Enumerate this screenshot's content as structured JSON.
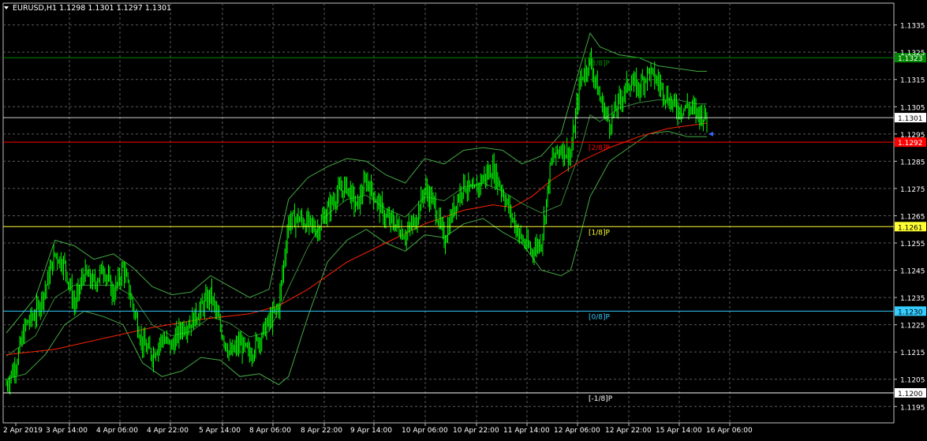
{
  "header": {
    "symbol_line": "EURUSD,H1  1.1298 1.1301 1.1297 1.1301"
  },
  "colors": {
    "background": "#000000",
    "grid": "#5a5a5a",
    "candles": "#00ff00",
    "bands": "#44aa44",
    "ma": "#ff2200",
    "axis_text": "#ffffff",
    "line_2_8": "#ff0000",
    "line_1_8": "#ffff33",
    "line_0_8": "#33ccff",
    "line_neg1_8": "#ffffff",
    "line_3_8": "#008800",
    "line_current": "#ffffff"
  },
  "chart_data": {
    "type": "candlestick",
    "symbol": "EURUSD",
    "timeframe": "H1",
    "ylim": [
      1.1189,
      1.1343
    ],
    "y_ticks": [
      "1.1335",
      "1.1325",
      "1.1315",
      "1.1305",
      "1.1295",
      "1.1285",
      "1.1275",
      "1.1265",
      "1.1255",
      "1.1245",
      "1.1235",
      "1.1225",
      "1.1215",
      "1.1205",
      "1.1195"
    ],
    "x_ticks": [
      "2 Apr 2019",
      "3 Apr 14:00",
      "4 Apr 06:00",
      "4 Apr 22:00",
      "5 Apr 14:00",
      "8 Apr 06:00",
      "8 Apr 22:00",
      "9 Apr 14:00",
      "10 Apr 06:00",
      "10 Apr 22:00",
      "11 Apr 14:00",
      "12 Apr 06:00",
      "12 Apr 22:00",
      "15 Apr 14:00",
      "16 Apr 06:00"
    ],
    "x_anchors": [
      {
        "index": 0,
        "label": "2 Apr 2019"
      },
      {
        "index": 144,
        "label": "16 Apr 06:00"
      }
    ],
    "close_path": [
      [
        0,
        1.1203
      ],
      [
        2,
        1.1211
      ],
      [
        4,
        1.1225
      ],
      [
        6,
        1.1229
      ],
      [
        8,
        1.1238
      ],
      [
        10,
        1.1251
      ],
      [
        12,
        1.1247
      ],
      [
        14,
        1.1232
      ],
      [
        16,
        1.1244
      ],
      [
        18,
        1.124
      ],
      [
        20,
        1.1246
      ],
      [
        22,
        1.1236
      ],
      [
        24,
        1.1246
      ],
      [
        26,
        1.1232
      ],
      [
        28,
        1.1218
      ],
      [
        30,
        1.1214
      ],
      [
        32,
        1.122
      ],
      [
        34,
        1.1217
      ],
      [
        36,
        1.1224
      ],
      [
        38,
        1.1226
      ],
      [
        40,
        1.1231
      ],
      [
        42,
        1.1236
      ],
      [
        44,
        1.1224
      ],
      [
        46,
        1.1214
      ],
      [
        48,
        1.1218
      ],
      [
        50,
        1.1214
      ],
      [
        52,
        1.122
      ],
      [
        54,
        1.1226
      ],
      [
        56,
        1.1232
      ],
      [
        58,
        1.1263
      ],
      [
        60,
        1.1264
      ],
      [
        62,
        1.1262
      ],
      [
        64,
        1.126
      ],
      [
        66,
        1.1267
      ],
      [
        68,
        1.1273
      ],
      [
        70,
        1.1276
      ],
      [
        72,
        1.1268
      ],
      [
        74,
        1.1278
      ],
      [
        76,
        1.1271
      ],
      [
        78,
        1.1264
      ],
      [
        80,
        1.1262
      ],
      [
        82,
        1.1258
      ],
      [
        84,
        1.1263
      ],
      [
        86,
        1.1275
      ],
      [
        88,
        1.1269
      ],
      [
        90,
        1.1256
      ],
      [
        92,
        1.1268
      ],
      [
        94,
        1.1277
      ],
      [
        96,
        1.1273
      ],
      [
        98,
        1.1279
      ],
      [
        100,
        1.1282
      ],
      [
        102,
        1.1274
      ],
      [
        104,
        1.1264
      ],
      [
        106,
        1.1256
      ],
      [
        108,
        1.1252
      ],
      [
        110,
        1.1256
      ],
      [
        112,
        1.1285
      ],
      [
        114,
        1.129
      ],
      [
        116,
        1.1287
      ],
      [
        118,
        1.1315
      ],
      [
        120,
        1.1322
      ],
      [
        122,
        1.1308
      ],
      [
        124,
        1.1299
      ],
      [
        126,
        1.1307
      ],
      [
        128,
        1.1314
      ],
      [
        130,
        1.1312
      ],
      [
        132,
        1.1318
      ],
      [
        134,
        1.1314
      ],
      [
        136,
        1.1308
      ],
      [
        138,
        1.1304
      ],
      [
        140,
        1.1305
      ],
      [
        142,
        1.1303
      ],
      [
        144,
        1.1301
      ]
    ],
    "moving_average_path": [
      [
        0,
        1.1214
      ],
      [
        10,
        1.1216
      ],
      [
        20,
        1.122
      ],
      [
        30,
        1.1224
      ],
      [
        40,
        1.1227
      ],
      [
        50,
        1.1229
      ],
      [
        56,
        1.1232
      ],
      [
        62,
        1.1238
      ],
      [
        70,
        1.1248
      ],
      [
        78,
        1.1255
      ],
      [
        86,
        1.1262
      ],
      [
        94,
        1.1267
      ],
      [
        100,
        1.1269
      ],
      [
        104,
        1.1268
      ],
      [
        108,
        1.1272
      ],
      [
        112,
        1.1278
      ],
      [
        118,
        1.1285
      ],
      [
        124,
        1.129
      ],
      [
        130,
        1.1294
      ],
      [
        136,
        1.1297
      ],
      [
        144,
        1.1299
      ]
    ],
    "band_upper_path": [
      [
        0,
        1.1222
      ],
      [
        6,
        1.1235
      ],
      [
        10,
        1.1256
      ],
      [
        14,
        1.1254
      ],
      [
        18,
        1.1249
      ],
      [
        22,
        1.1251
      ],
      [
        26,
        1.1246
      ],
      [
        30,
        1.1239
      ],
      [
        34,
        1.1236
      ],
      [
        38,
        1.1237
      ],
      [
        42,
        1.1243
      ],
      [
        46,
        1.1239
      ],
      [
        50,
        1.1235
      ],
      [
        54,
        1.1238
      ],
      [
        58,
        1.1271
      ],
      [
        62,
        1.1279
      ],
      [
        66,
        1.1283
      ],
      [
        70,
        1.1286
      ],
      [
        74,
        1.1285
      ],
      [
        78,
        1.128
      ],
      [
        82,
        1.1277
      ],
      [
        86,
        1.1286
      ],
      [
        90,
        1.1284
      ],
      [
        94,
        1.1289
      ],
      [
        98,
        1.129
      ],
      [
        102,
        1.1289
      ],
      [
        106,
        1.1284
      ],
      [
        110,
        1.1287
      ],
      [
        114,
        1.1295
      ],
      [
        118,
        1.132
      ],
      [
        120,
        1.1332
      ],
      [
        122,
        1.1327
      ],
      [
        126,
        1.1324
      ],
      [
        130,
        1.1323
      ],
      [
        134,
        1.132
      ],
      [
        138,
        1.1319
      ],
      [
        142,
        1.1318
      ],
      [
        144,
        1.1318
      ]
    ],
    "band_lower_path": [
      [
        0,
        1.1205
      ],
      [
        4,
        1.1207
      ],
      [
        8,
        1.1214
      ],
      [
        12,
        1.1225
      ],
      [
        16,
        1.123
      ],
      [
        20,
        1.1228
      ],
      [
        24,
        1.1225
      ],
      [
        28,
        1.1211
      ],
      [
        32,
        1.1206
      ],
      [
        36,
        1.1208
      ],
      [
        40,
        1.1213
      ],
      [
        44,
        1.1212
      ],
      [
        48,
        1.1206
      ],
      [
        52,
        1.1207
      ],
      [
        56,
        1.1203
      ],
      [
        58,
        1.1206
      ],
      [
        62,
        1.1228
      ],
      [
        66,
        1.1248
      ],
      [
        70,
        1.1256
      ],
      [
        74,
        1.126
      ],
      [
        78,
        1.1255
      ],
      [
        82,
        1.1252
      ],
      [
        86,
        1.1258
      ],
      [
        90,
        1.1257
      ],
      [
        94,
        1.1262
      ],
      [
        98,
        1.1264
      ],
      [
        102,
        1.1259
      ],
      [
        106,
        1.1255
      ],
      [
        110,
        1.1245
      ],
      [
        114,
        1.1243
      ],
      [
        116,
        1.1245
      ],
      [
        118,
        1.1258
      ],
      [
        120,
        1.1272
      ],
      [
        124,
        1.1285
      ],
      [
        128,
        1.129
      ],
      [
        132,
        1.1295
      ],
      [
        136,
        1.1296
      ],
      [
        140,
        1.1294
      ],
      [
        144,
        1.1294
      ]
    ],
    "current_price": "1.1301",
    "murrey_levels": [
      {
        "label": "[3/8]P",
        "value": "1.1323",
        "price": 1.1323
      },
      {
        "label": "[2/8]P",
        "value": "1.1292",
        "price": 1.1292
      },
      {
        "label": "[1/8]P",
        "value": "1.1261",
        "price": 1.1261
      },
      {
        "label": "[0/8]P",
        "value": "1.1230",
        "price": 1.123
      },
      {
        "label": "[-1/8]P",
        "value": "1.1200",
        "price": 1.12
      }
    ]
  }
}
